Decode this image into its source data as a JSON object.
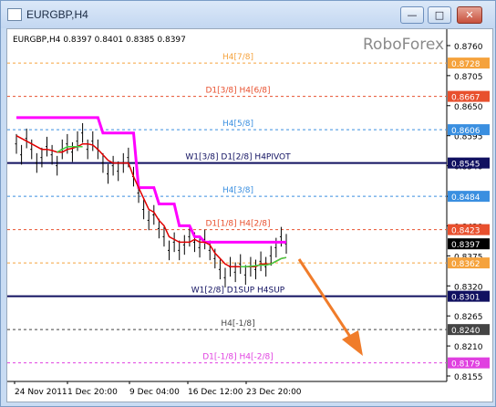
{
  "window": {
    "title": "EURGBP,H4"
  },
  "chart_data": {
    "type": "line",
    "header": "EURGBP,H4  0.8397 0.8401 0.8385 0.8397",
    "watermark": "RoboForex",
    "ylim": [
      0.8145,
      0.879
    ],
    "y_ticks": [
      "0.8760",
      "0.8705",
      "0.8650",
      "0.8595",
      "0.8540",
      "0.8484",
      "0.8430",
      "0.8375",
      "0.8320",
      "0.8265",
      "0.8210",
      "0.8155"
    ],
    "x_ticks": [
      "24 Nov 2011",
      "1 Dec 20:00",
      "9 Dec 04:00",
      "16 Dec 12:00",
      "23 Dec 20:00"
    ],
    "levels": [
      {
        "label": "H4[7/8]",
        "value": 0.8728,
        "value_text": "0.8728",
        "color": "#f5a23c",
        "style": "dashed"
      },
      {
        "label": "D1[3/8] H4[6/8]",
        "value": 0.8667,
        "value_text": "0.8667",
        "color": "#e8502e",
        "style": "dashed"
      },
      {
        "label": "H4[5/8]",
        "value": 0.8606,
        "value_text": "0.8606",
        "color": "#3a8fe0",
        "style": "dashed"
      },
      {
        "label": "W1[3/8] D1[2/8] H4PIVOT",
        "value": 0.8545,
        "value_text": "0.8545",
        "color": "#101060",
        "style": "solid"
      },
      {
        "label": "H4[3/8]",
        "value": 0.8484,
        "value_text": "0.8484",
        "color": "#3a8fe0",
        "style": "dashed"
      },
      {
        "label": "D1[1/8] H4[2/8]",
        "value": 0.8423,
        "value_text": "0.8423",
        "color": "#e8502e",
        "style": "dashed"
      },
      {
        "label": "",
        "value": 0.8362,
        "value_text": "0.8362",
        "color": "#f5a23c",
        "style": "dashed"
      },
      {
        "label": "W1[2/8] D1SUP H4SUP",
        "value": 0.8301,
        "value_text": "0.8301",
        "color": "#101060",
        "style": "solid"
      },
      {
        "label": "H4[-1/8]",
        "value": 0.824,
        "value_text": "0.8240",
        "color": "#444444",
        "style": "dashed"
      },
      {
        "label": "D1[-1/8] H4[-2/8]",
        "value": 0.8179,
        "value_text": "0.8179",
        "color": "#e040e0",
        "style": "dashed"
      }
    ],
    "current_price": {
      "value": 0.8397,
      "value_text": "0.8397"
    },
    "price_series": [
      0.858,
      0.856,
      0.859,
      0.857,
      0.8545,
      0.8555,
      0.8575,
      0.856,
      0.854,
      0.857,
      0.858,
      0.8565,
      0.8585,
      0.86,
      0.857,
      0.8585,
      0.857,
      0.8545,
      0.8525,
      0.854,
      0.853,
      0.8545,
      0.8555,
      0.852,
      0.849,
      0.846,
      0.844,
      0.845,
      0.8425,
      0.841,
      0.8385,
      0.84,
      0.8385,
      0.8395,
      0.841,
      0.84,
      0.839,
      0.8405,
      0.8385,
      0.837,
      0.835,
      0.8335,
      0.8355,
      0.8345,
      0.836,
      0.834,
      0.8355,
      0.835,
      0.8365,
      0.8355,
      0.8375,
      0.839,
      0.841,
      0.8397
    ],
    "series": [
      {
        "name": "",
        "color": "#ff00ff",
        "values": [
          0.8628,
          0.8628,
          0.8628,
          0.8628,
          0.8628,
          0.8628,
          0.8628,
          0.8628,
          0.8628,
          0.8628,
          0.8628,
          0.8628,
          0.8628,
          0.8628,
          0.8628,
          0.8628,
          0.8628,
          0.86,
          0.86,
          0.86,
          0.86,
          0.86,
          0.86,
          0.86,
          0.85,
          0.85,
          0.85,
          0.85,
          0.847,
          0.847,
          0.847,
          0.847,
          0.843,
          0.843,
          0.843,
          0.841,
          0.841,
          0.84,
          0.84,
          0.84,
          0.84,
          0.84,
          0.84,
          0.84,
          0.84,
          0.84,
          0.84,
          0.84,
          0.84,
          0.84,
          0.84,
          0.84,
          0.84,
          0.84
        ]
      },
      {
        "name": "",
        "color": "#e00000",
        "values": [
          0.8595,
          0.859,
          0.8585,
          0.858,
          0.8575,
          0.857,
          0.857,
          0.8568,
          0.8565,
          0.8565,
          0.857,
          0.8572,
          0.8575,
          0.858,
          0.858,
          0.8578,
          0.857,
          0.856,
          0.855,
          0.8545,
          0.8545,
          0.8545,
          0.8545,
          0.852,
          0.85,
          0.848,
          0.846,
          0.8455,
          0.844,
          0.843,
          0.841,
          0.8405,
          0.84,
          0.84,
          0.84,
          0.8405,
          0.84,
          0.84,
          0.8395,
          0.838,
          0.837,
          0.836,
          0.8355,
          0.8355,
          0.8355,
          0.8355,
          0.8355,
          0.8355,
          0.836,
          0.836,
          0.836,
          0.8365,
          0.837,
          0.8372
        ]
      },
      {
        "name": "",
        "color": "#40d040",
        "values": [
          null,
          null,
          null,
          null,
          null,
          null,
          null,
          null,
          0.8565,
          0.857,
          0.8575,
          0.8575,
          0.8575,
          0.8575,
          null,
          null,
          null,
          null,
          null,
          null,
          null,
          null,
          null,
          null,
          null,
          null,
          null,
          null,
          null,
          null,
          null,
          null,
          null,
          null,
          null,
          null,
          null,
          null,
          null,
          null,
          null,
          null,
          null,
          null,
          0.8355,
          0.8355,
          0.8356,
          0.8357,
          0.8358,
          0.8358,
          0.836,
          0.8365,
          0.837,
          0.8372
        ]
      }
    ]
  }
}
